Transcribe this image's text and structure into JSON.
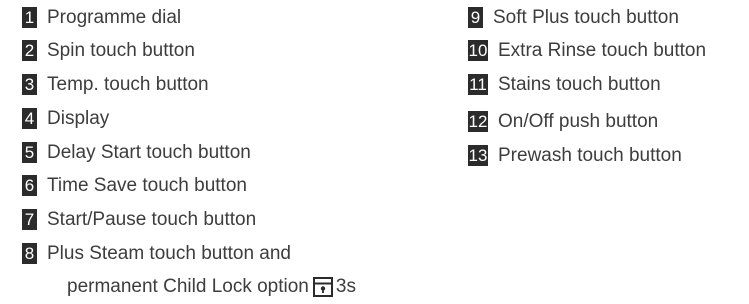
{
  "legend": {
    "items": [
      {
        "number": "1",
        "label": "Programme dial"
      },
      {
        "number": "2",
        "label": "Spin touch button"
      },
      {
        "number": "3",
        "label": "Temp. touch button"
      },
      {
        "number": "4",
        "label": "Display"
      },
      {
        "number": "5",
        "label": "Delay Start touch button"
      },
      {
        "number": "6",
        "label": "Time Save touch button"
      },
      {
        "number": "7",
        "label": "Start/Pause touch button"
      },
      {
        "number": "8",
        "label": "Plus Steam touch button and",
        "label_line2": "permanent Child Lock option",
        "suffix": "3s",
        "icon": "child-lock-icon"
      },
      {
        "number": "9",
        "label": "Soft Plus touch button"
      },
      {
        "number": "10",
        "label": "Extra Rinse touch button"
      },
      {
        "number": "11",
        "label": "Stains touch button"
      },
      {
        "number": "12",
        "label": "On/Off push button"
      },
      {
        "number": "13",
        "label": "Prewash touch button"
      }
    ]
  },
  "colors": {
    "badge_bg": "#2b2b2b",
    "text": "#3d3d3d"
  }
}
